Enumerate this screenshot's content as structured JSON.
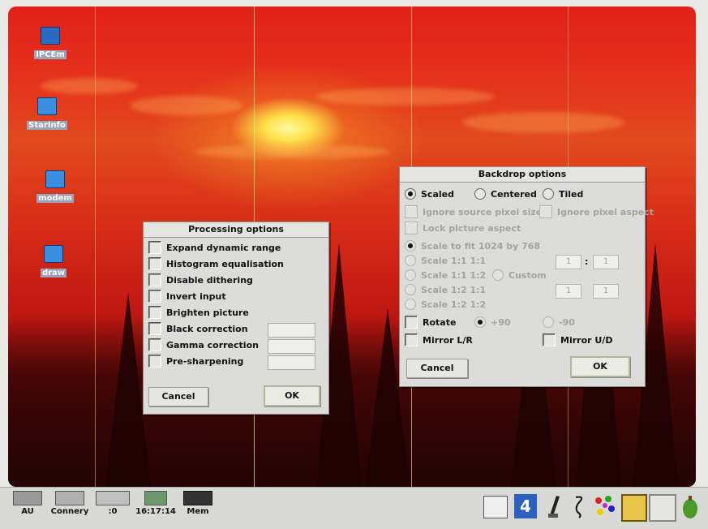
{
  "desktop": {
    "icons": [
      {
        "name": "pcem-icon",
        "label": "IPCEm"
      },
      {
        "name": "starinfo-icon",
        "label": "StarInfo"
      },
      {
        "name": "modem-icon",
        "label": "modem"
      },
      {
        "name": "draw-icon",
        "label": "draw"
      }
    ]
  },
  "processing": {
    "title": "Processing options",
    "options": [
      "Expand dynamic range",
      "Histogram equalisation",
      "Disable dithering",
      "Invert input",
      "Brighten picture",
      "Black correction",
      "Gamma correction",
      "Pre-sharpening"
    ],
    "cancel_label": "Cancel",
    "ok_label": "OK"
  },
  "backdrop": {
    "title": "Backdrop options",
    "scaled_label": "Scaled",
    "centered_label": "Centered",
    "tiled_label": "Tiled",
    "selected_mode": "Scaled",
    "ignore_source_label": "Ignore source pixel size",
    "ignore_aspect_label": "Ignore pixel aspect",
    "lock_aspect_label": "Lock picture aspect",
    "scale_fit_label": "Scale to fit 1024 by 768",
    "scale_11_11_label": "Scale 1:1 1:1",
    "scale_11_12_label": "Scale 1:1 1:2",
    "custom_label": "Custom",
    "scale_12_11_label": "Scale 1:2 1:1",
    "scale_12_12_label": "Scale 1:2 1:2",
    "ratio_a1": "1",
    "ratio_sep1": ":",
    "ratio_b1": "1",
    "ratio_a2": "1",
    "ratio_b2": "1",
    "rotate_label": "Rotate",
    "rotate_pos": "+90",
    "rotate_neg": "-90",
    "mirror_lr_label": "Mirror L/R",
    "mirror_ud_label": "Mirror U/D",
    "cancel_label": "Cancel",
    "ok_label": "OK"
  },
  "iconbar": {
    "left_items": [
      {
        "name": "drive-au",
        "label": "AU"
      },
      {
        "name": "drive-connery",
        "label": "Connery"
      },
      {
        "name": "drive-zero",
        "label": ":0"
      },
      {
        "name": "clock",
        "label": "16:17:14"
      },
      {
        "name": "memory",
        "label": "Mem"
      }
    ]
  }
}
